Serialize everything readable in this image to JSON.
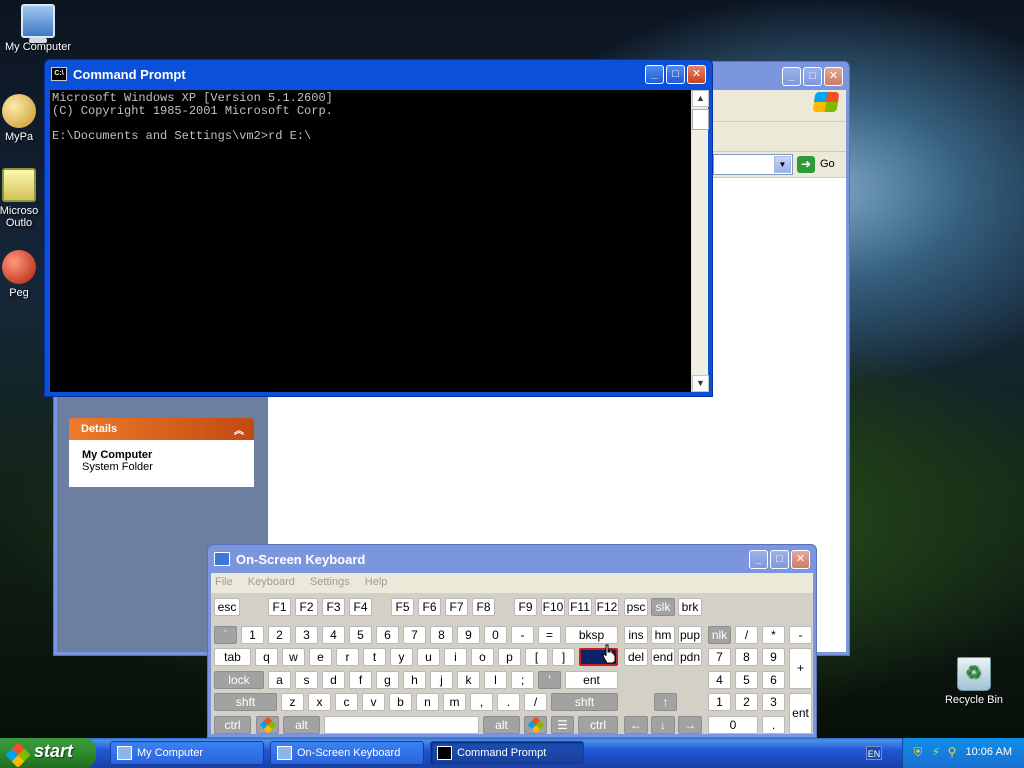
{
  "desktop": {
    "icons": [
      {
        "label": "My Computer",
        "icon": "my-computer-icon"
      },
      {
        "label": "MyPa",
        "icon": "my-pictures-icon"
      },
      {
        "label": "Microso Outlo",
        "icon": "outlook-icon"
      },
      {
        "label": "Peg",
        "icon": "pegasus-icon"
      },
      {
        "label": "Recycle Bin",
        "icon": "recycle-bin-icon"
      }
    ]
  },
  "explorer": {
    "title": "",
    "go_label": "Go",
    "details": {
      "header": "Details",
      "name": "My Computer",
      "type": "System Folder"
    }
  },
  "cmd": {
    "title": "Command Prompt",
    "lines": [
      "Microsoft Windows XP [Version 5.1.2600]",
      "(C) Copyright 1985-2001 Microsoft Corp.",
      "",
      "E:\\Documents and Settings\\vm2>rd E:\\"
    ]
  },
  "osk": {
    "title": "On-Screen Keyboard",
    "menu": [
      "File",
      "Keyboard",
      "Settings",
      "Help"
    ],
    "keys": {
      "esc": "esc",
      "f1": "F1",
      "f2": "F2",
      "f3": "F3",
      "f4": "F4",
      "f5": "F5",
      "f6": "F6",
      "f7": "F7",
      "f8": "F8",
      "f9": "F9",
      "f10": "F10",
      "f11": "F11",
      "f12": "F12",
      "psc": "psc",
      "slk": "slk",
      "brk": "brk",
      "grave": "`",
      "n1": "1",
      "n2": "2",
      "n3": "3",
      "n4": "4",
      "n5": "5",
      "n6": "6",
      "n7": "7",
      "n8": "8",
      "n9": "9",
      "n0": "0",
      "minus": "-",
      "equals": "=",
      "bksp": "bksp",
      "ins": "ins",
      "hm": "hm",
      "pup": "pup",
      "nlk": "nlk",
      "kp_div": "/",
      "kp_mul": "*",
      "kp_sub": "-",
      "tab": "tab",
      "q": "q",
      "w": "w",
      "e": "e",
      "r": "r",
      "t": "t",
      "y": "y",
      "u": "u",
      "i": "i",
      "o": "o",
      "p": "p",
      "lbr": "[",
      "rbr": "]",
      "bslash": "",
      "del": "del",
      "end": "end",
      "pdn": "pdn",
      "kp7": "7",
      "kp8": "8",
      "kp9": "9",
      "kp_add": "+",
      "lock": "lock",
      "a": "a",
      "s": "s",
      "d": "d",
      "f": "f",
      "g": "g",
      "h": "h",
      "j": "j",
      "k": "k",
      "l": "l",
      "semi": ";",
      "quote": "'",
      "ent": "ent",
      "kp4": "4",
      "kp5": "5",
      "kp6": "6",
      "lshft": "shft",
      "z": "z",
      "x": "x",
      "c": "c",
      "v": "v",
      "b": "b",
      "n": "n",
      "m": "m",
      "comma": ",",
      "period": ".",
      "slash": "/",
      "rshft": "shft",
      "up": "↑",
      "kp1": "1",
      "kp2": "2",
      "kp3": "3",
      "kp_ent": "ent",
      "lctrl": "ctrl",
      "lalt": "alt",
      "space": "",
      "ralt": "alt",
      "rctrl": "ctrl",
      "left": "←",
      "down": "↓",
      "right": "→",
      "kp0": "0",
      "kp_dot": "."
    }
  },
  "taskbar": {
    "start_label": "start",
    "tasks": [
      {
        "label": "My Computer",
        "icon": "my-computer-icon"
      },
      {
        "label": "On-Screen Keyboard",
        "icon": "keyboard-icon"
      },
      {
        "label": "Command Prompt",
        "icon": "cmd-icon"
      }
    ],
    "lang": "EN",
    "clock": "10:06 AM"
  }
}
